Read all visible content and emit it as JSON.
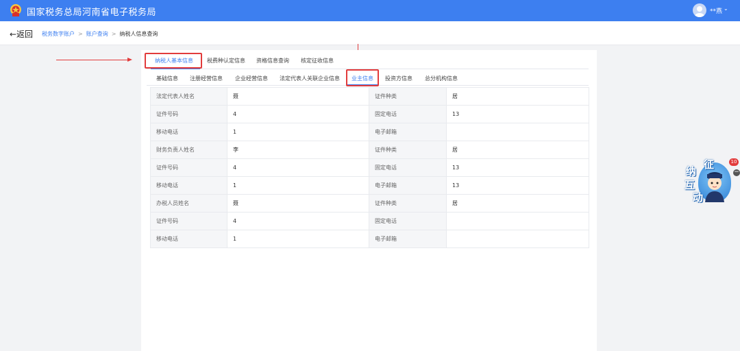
{
  "header": {
    "title": "国家税务总局河南省电子税务局",
    "user_name": "**燕",
    "user_chevron": "⌄",
    "colors": {
      "bar": "#3d7ff0",
      "highlight": "#e23b3b"
    }
  },
  "breadcrumb": {
    "back_label": "←返回",
    "items": [
      "税务数字账户",
      "账户查询",
      "纳税人信息查询"
    ],
    "separator": ">"
  },
  "tabs_top": {
    "items": [
      "纳税人基本信息",
      "税费种认定信息",
      "资格信息查询",
      "核定征收信息"
    ],
    "active": "纳税人基本信息"
  },
  "tabs_sub": {
    "items": [
      "基础信息",
      "注册经营信息",
      "企业经营信息",
      "法定代表人关联企业信息",
      "业主信息",
      "投资方信息",
      "总分机构信息"
    ],
    "active": "业主信息"
  },
  "info_table": {
    "rows": [
      {
        "k1": "法定代表人姓名",
        "v1": "聂",
        "k2": "证件种类",
        "v2": "居"
      },
      {
        "k1": "证件号码",
        "v1": "4",
        "k2": "固定电话",
        "v2": "13"
      },
      {
        "k1": "移动电话",
        "v1": "1",
        "k2": "电子邮箱",
        "v2": ""
      },
      {
        "k1": "财务负责人姓名",
        "v1": "李",
        "k2": "证件种类",
        "v2": "居"
      },
      {
        "k1": "证件号码",
        "v1": "4",
        "k2": "固定电话",
        "v2": "13"
      },
      {
        "k1": "移动电话",
        "v1": "1",
        "k2": "电子邮箱",
        "v2": "13"
      },
      {
        "k1": "办税人员姓名",
        "v1": "聂",
        "k2": "证件种类",
        "v2": "居"
      },
      {
        "k1": "证件号码",
        "v1": "4",
        "k2": "固定电话",
        "v2": ""
      },
      {
        "k1": "移动电话",
        "v1": "1",
        "k2": "电子邮箱",
        "v2": ""
      }
    ]
  },
  "widget": {
    "chars": [
      "征",
      "纳",
      "互",
      "动"
    ],
    "badge": "10",
    "minus": "−"
  }
}
